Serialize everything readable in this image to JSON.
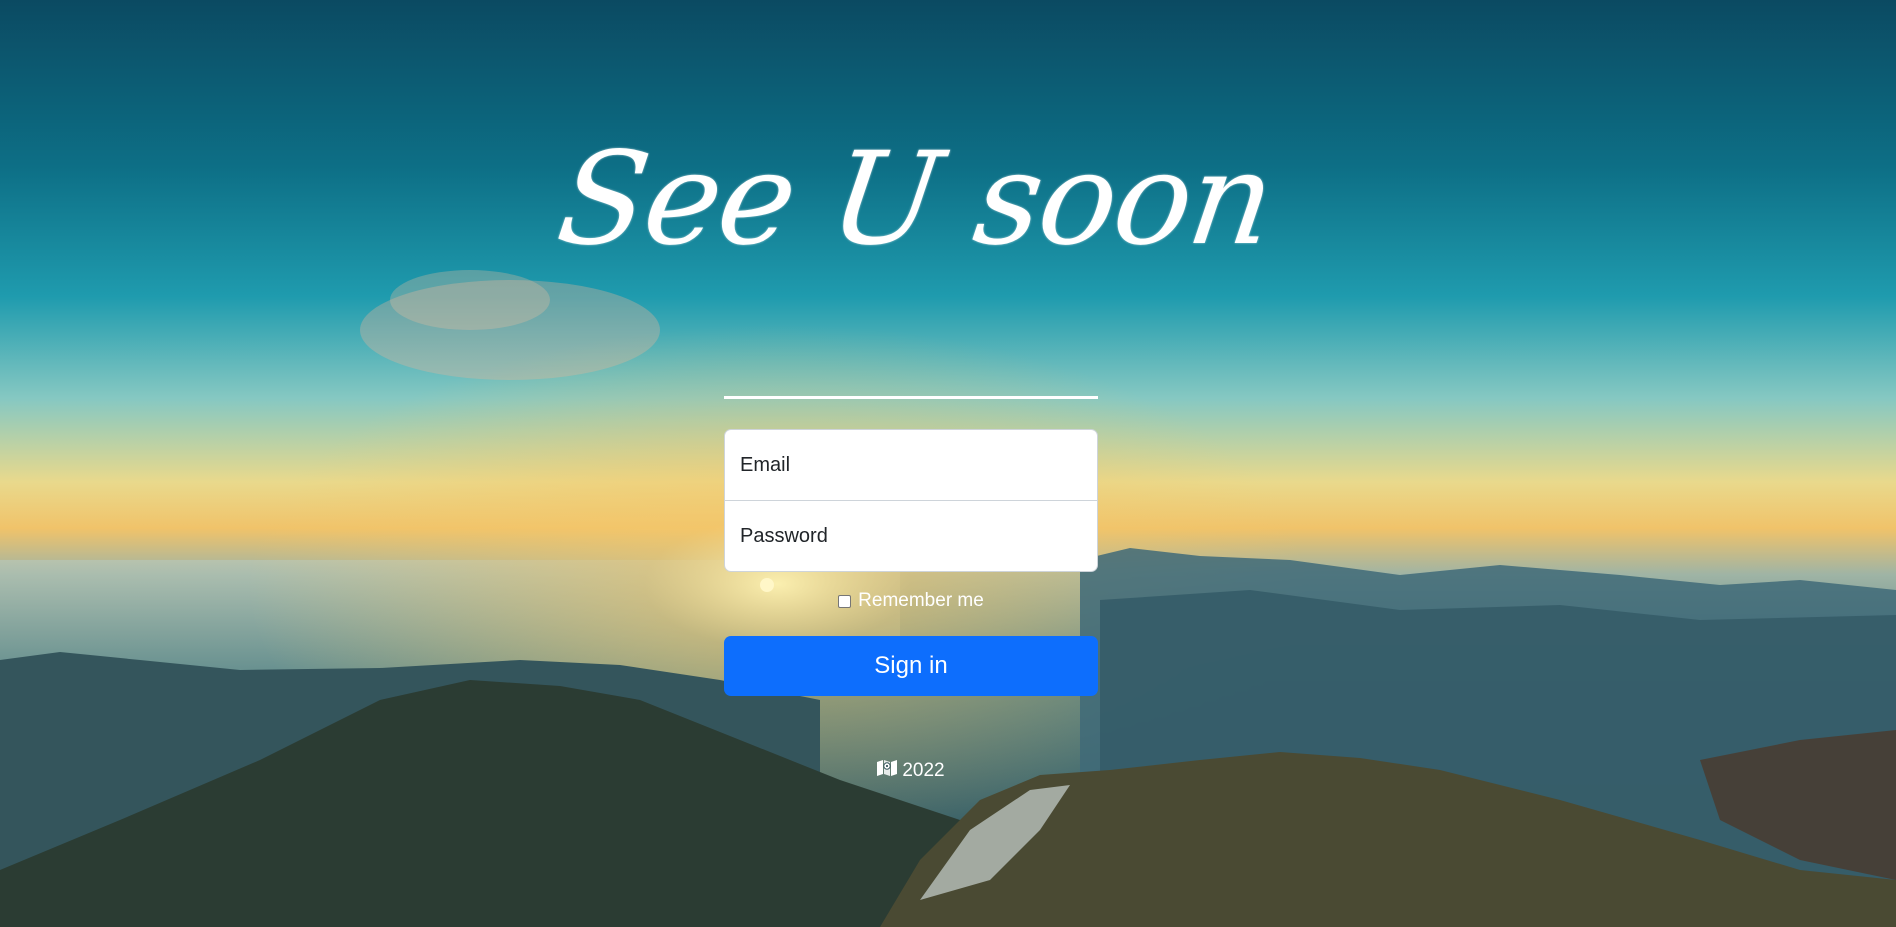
{
  "logo": {
    "text": "See U soon"
  },
  "form": {
    "email_placeholder": "Email",
    "password_placeholder": "Password",
    "remember_label": "Remember me",
    "remember_checked": false,
    "submit_label": "Sign in"
  },
  "footer": {
    "icon": "map-icon",
    "year": "2022"
  },
  "colors": {
    "primary": "#0d6efd",
    "sky_top": "#0b4f66",
    "horizon": "#f1d27a"
  }
}
